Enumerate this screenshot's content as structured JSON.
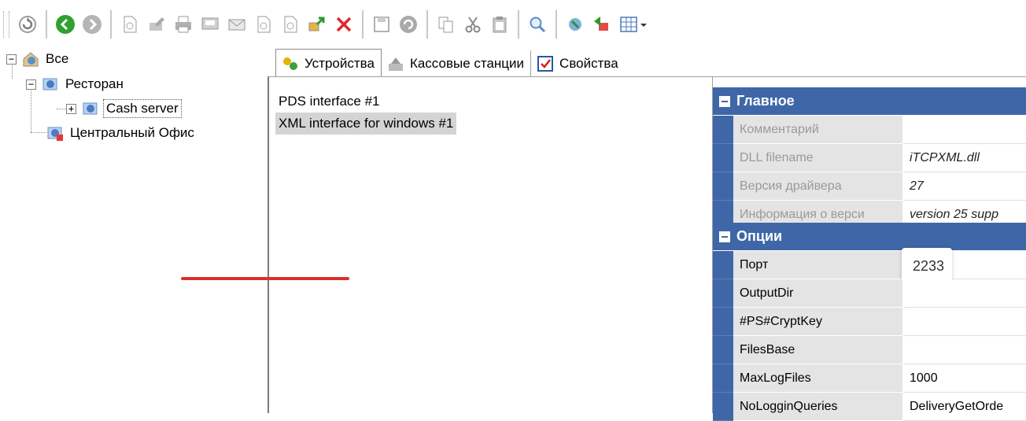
{
  "toolbar": {
    "icons": [
      "refresh-icon",
      "back-icon",
      "forward-icon",
      "new-doc-icon",
      "edit-icon",
      "print-icon",
      "print-preview-icon",
      "envelope-icon",
      "doc-icon",
      "doc2-icon",
      "export-icon",
      "delete-icon",
      "save-icon",
      "undo-icon",
      "copy-icon",
      "cut-icon",
      "paste-icon",
      "search-icon",
      "filter-icon",
      "import-icon",
      "grid-icon"
    ]
  },
  "tree": {
    "root": "Все",
    "restaurant": "Ресторан",
    "cash_server": "Cash server",
    "central_office": "Центральный Офис"
  },
  "tabs": [
    {
      "label": "Устройства",
      "icon": "devices-icon"
    },
    {
      "label": "Кассовые станции",
      "icon": "cash-station-icon"
    },
    {
      "label": "Свойства",
      "icon": "properties-icon"
    }
  ],
  "devices": [
    {
      "label": "PDS interface #1"
    },
    {
      "label": "XML interface for windows #1"
    }
  ],
  "properties": {
    "main_category": "Главное",
    "main_rows": [
      {
        "name": "Комментарий",
        "value": ""
      },
      {
        "name": "DLL filename",
        "value": "iTCPXML.dll"
      },
      {
        "name": "Версия драйвера",
        "value": "27"
      },
      {
        "name": "Информация о верси",
        "value": "version 25 supp"
      }
    ],
    "options_category": "Опции",
    "port": {
      "name": "Порт",
      "value": "2233"
    },
    "options_rows": [
      {
        "name": "OutputDir",
        "value": ""
      },
      {
        "name": "#PS#CryptKey",
        "value": ""
      },
      {
        "name": "FilesBase",
        "value": ""
      },
      {
        "name": "MaxLogFiles",
        "value": "1000"
      },
      {
        "name": "NoLogginQueries",
        "value": "DeliveryGetOrde"
      }
    ]
  },
  "colors": {
    "category_bg": "#3f67a8",
    "name_bg": "#e4e4e4",
    "highlight_underline": "#d9312b",
    "selected_item": "#d4d4d4"
  }
}
